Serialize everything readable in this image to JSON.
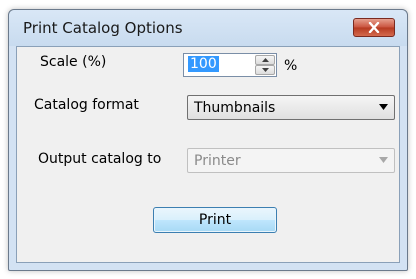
{
  "window": {
    "title": "Print Catalog Options"
  },
  "scale": {
    "label": "Scale (%)",
    "value": "100",
    "unit": "%"
  },
  "catalog_format": {
    "label": "Catalog format",
    "selected": "Thumbnails"
  },
  "output": {
    "label": "Output catalog to",
    "selected": "Printer",
    "enabled": false
  },
  "actions": {
    "print_label": "Print"
  },
  "icons": {
    "close": "close-icon",
    "spin_up": "chevron-up-icon",
    "spin_down": "chevron-down-icon",
    "combo_arrow": "dropdown-arrow-icon"
  },
  "colors": {
    "selection": "#3399ff",
    "close_button": "#c9523c",
    "title_bar": "#d3e2f3"
  }
}
